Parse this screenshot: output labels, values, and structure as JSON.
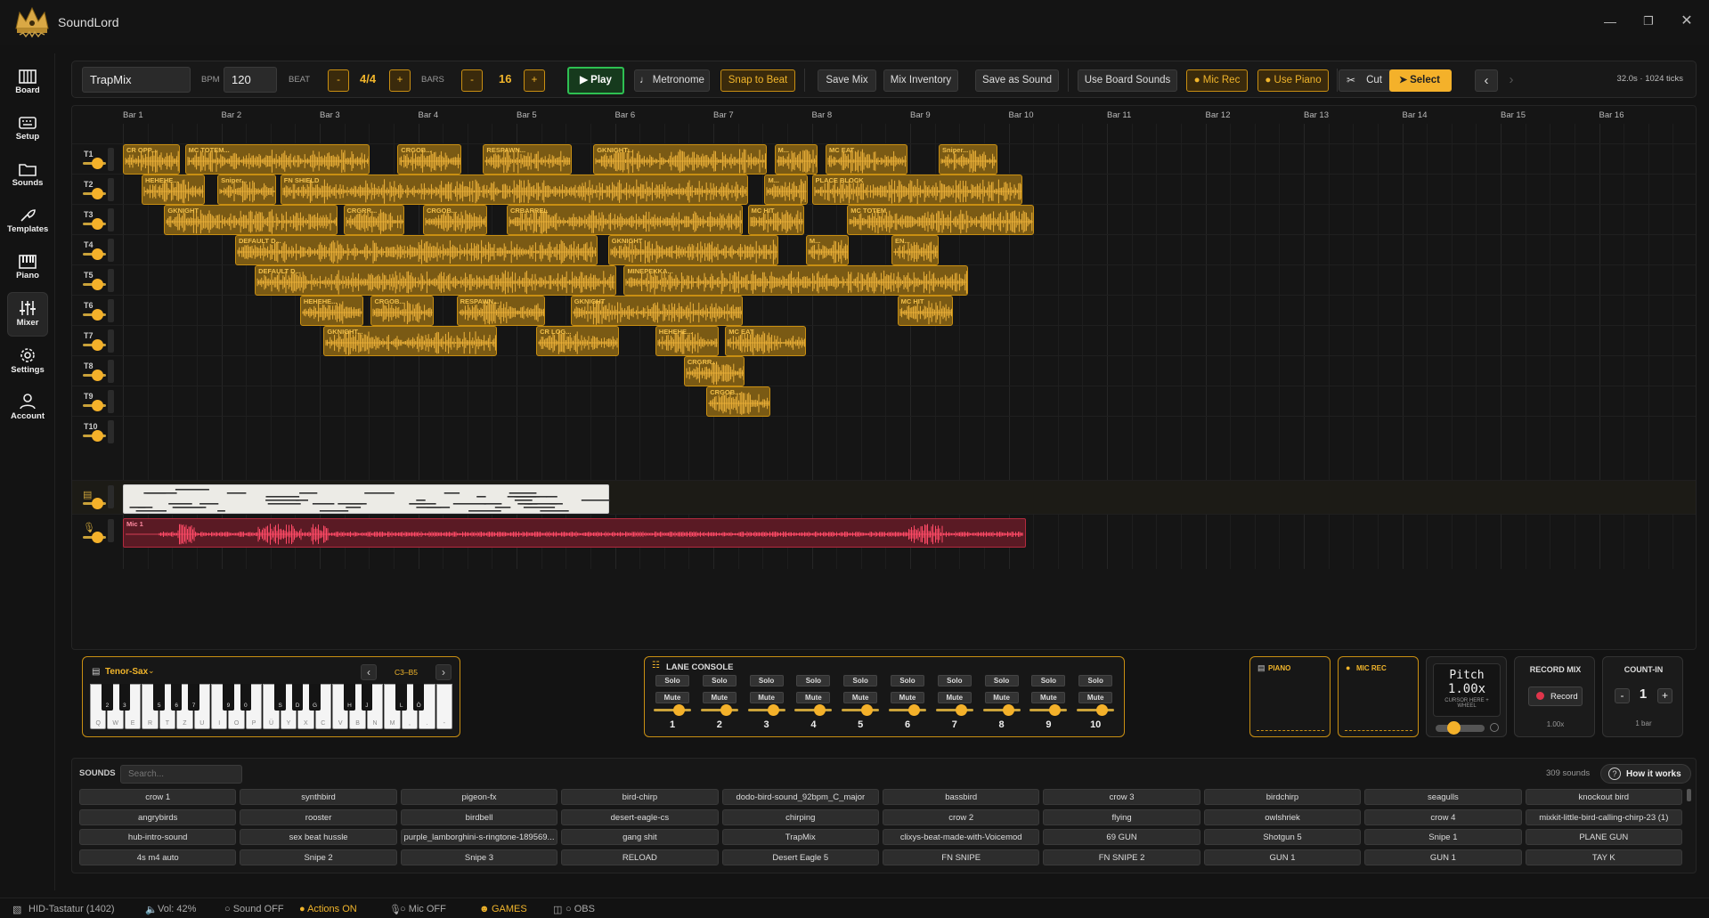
{
  "app": {
    "title": "SoundLord"
  },
  "sidebar": {
    "items": [
      {
        "label": "Board",
        "icon": "piano-grid-icon"
      },
      {
        "label": "Setup",
        "icon": "keyboard-icon"
      },
      {
        "label": "Sounds",
        "icon": "folder-icon"
      },
      {
        "label": "Templates",
        "icon": "templates-icon"
      },
      {
        "label": "Piano",
        "icon": "piano-icon"
      },
      {
        "label": "Mixer",
        "icon": "mixer-icon"
      },
      {
        "label": "Settings",
        "icon": "gear-icon"
      },
      {
        "label": "Account",
        "icon": "user-icon"
      }
    ]
  },
  "toolbar": {
    "project_name": "TrapMix",
    "bpm_label": "BPM",
    "bpm_value": "120",
    "beat_label": "BEAT",
    "beat_value": "4/4",
    "bars_label": "BARS",
    "bars_value": "16",
    "minus": "-",
    "plus": "+",
    "play_label": "▶ Play",
    "metronome_label": "♩ Metronome",
    "snap_label": "Snap to Beat",
    "save_mix_label": "Save Mix",
    "mix_inventory_label": "Mix Inventory",
    "save_sound_label": "Save as Sound",
    "board_sounds_label": "Use Board Sounds",
    "mic_rec_label": "● Mic Rec",
    "use_piano_label": "● Use Piano",
    "cut_label": "Cut",
    "select_label": "Select",
    "prev": "‹",
    "next": "›",
    "duration_info": "32.0s · 1024 ticks"
  },
  "timeline": {
    "bars": [
      "Bar 1",
      "Bar 2",
      "Bar 3",
      "Bar 4",
      "Bar 5",
      "Bar 6",
      "Bar 7",
      "Bar 8",
      "Bar 9",
      "Bar 10",
      "Bar 11",
      "Bar 12",
      "Bar 13",
      "Bar 14",
      "Bar 15",
      "Bar 16"
    ],
    "lanes": [
      "T1",
      "T2",
      "T3",
      "T4",
      "T5",
      "T6",
      "T7",
      "T8",
      "T9",
      "T10"
    ],
    "clips": [
      {
        "lane": 0,
        "start": 0.0,
        "len": 0.58,
        "name": "CR OPP..."
      },
      {
        "lane": 0,
        "start": 0.63,
        "len": 1.88,
        "name": "MC TOTEM..."
      },
      {
        "lane": 0,
        "start": 2.79,
        "len": 0.65,
        "name": "CRGOB..."
      },
      {
        "lane": 0,
        "start": 3.66,
        "len": 0.9,
        "name": "RESPAWN..."
      },
      {
        "lane": 0,
        "start": 4.78,
        "len": 1.76,
        "name": "GKNIGHT..."
      },
      {
        "lane": 0,
        "start": 6.62,
        "len": 0.44,
        "name": "M..."
      },
      {
        "lane": 0,
        "start": 7.14,
        "len": 0.83,
        "name": "MC EAT"
      },
      {
        "lane": 0,
        "start": 8.29,
        "len": 0.6,
        "name": "Sniper..."
      },
      {
        "lane": 1,
        "start": 0.19,
        "len": 0.64,
        "name": "HEHEHE..."
      },
      {
        "lane": 1,
        "start": 0.96,
        "len": 0.6,
        "name": "Sniper..."
      },
      {
        "lane": 1,
        "start": 1.6,
        "len": 4.75,
        "name": "FN SHIELD"
      },
      {
        "lane": 1,
        "start": 6.52,
        "len": 0.44,
        "name": "M..."
      },
      {
        "lane": 1,
        "start": 7.0,
        "len": 2.14,
        "name": "PLACE BLOCK"
      },
      {
        "lane": 2,
        "start": 0.42,
        "len": 1.76,
        "name": "GKNIGHT"
      },
      {
        "lane": 2,
        "start": 2.24,
        "len": 0.62,
        "name": "CRGRR..."
      },
      {
        "lane": 2,
        "start": 3.05,
        "len": 0.65,
        "name": "CRGOB..."
      },
      {
        "lane": 2,
        "start": 3.9,
        "len": 2.4,
        "name": "CRBARREL"
      },
      {
        "lane": 2,
        "start": 6.35,
        "len": 0.57,
        "name": "MC HIT"
      },
      {
        "lane": 2,
        "start": 7.36,
        "len": 1.9,
        "name": "MC TOTEM"
      },
      {
        "lane": 3,
        "start": 1.14,
        "len": 3.68,
        "name": "DEFAULT D..."
      },
      {
        "lane": 3,
        "start": 4.93,
        "len": 1.73,
        "name": "GKNIGHT"
      },
      {
        "lane": 3,
        "start": 6.94,
        "len": 0.44,
        "name": "M..."
      },
      {
        "lane": 3,
        "start": 7.81,
        "len": 0.48,
        "name": "EN..."
      },
      {
        "lane": 4,
        "start": 1.34,
        "len": 3.67,
        "name": "DEFAULT D..."
      },
      {
        "lane": 4,
        "start": 5.09,
        "len": 3.5,
        "name": "MINEPEKKA..."
      },
      {
        "lane": 5,
        "start": 1.8,
        "len": 0.64,
        "name": "HEHEHE..."
      },
      {
        "lane": 5,
        "start": 2.52,
        "len": 0.64,
        "name": "CRGOB..."
      },
      {
        "lane": 5,
        "start": 3.39,
        "len": 0.9,
        "name": "RESPAWN..."
      },
      {
        "lane": 5,
        "start": 4.55,
        "len": 1.75,
        "name": "GKNIGHT"
      },
      {
        "lane": 5,
        "start": 7.87,
        "len": 0.56,
        "name": "MC HIT"
      },
      {
        "lane": 6,
        "start": 2.04,
        "len": 1.76,
        "name": "GKNIGHT..."
      },
      {
        "lane": 6,
        "start": 4.2,
        "len": 0.84,
        "name": "CR LOG..."
      },
      {
        "lane": 6,
        "start": 5.41,
        "len": 0.64,
        "name": "HEHEHE..."
      },
      {
        "lane": 6,
        "start": 6.12,
        "len": 0.82,
        "name": "MC EAT"
      },
      {
        "lane": 7,
        "start": 5.7,
        "len": 0.62,
        "name": "CRGRR..."
      },
      {
        "lane": 8,
        "start": 5.93,
        "len": 0.65,
        "name": "CRGOB..."
      }
    ],
    "mic_clip_name": "Mic 1"
  },
  "piano_panel": {
    "instrument": "Tenor-Sax",
    "range": "C3–B5",
    "white_keys": [
      "Q",
      "W",
      "E",
      "R",
      "T",
      "Z",
      "U",
      "I",
      "O",
      "P",
      "Ü",
      "Y",
      "X",
      "C",
      "V",
      "B",
      "N",
      "M",
      ",",
      ".",
      "-"
    ],
    "black_keys": [
      "2",
      "3",
      "5",
      "6",
      "7",
      "9",
      "0",
      "S",
      "D",
      "G",
      "H",
      "J",
      "L",
      "Ö"
    ]
  },
  "lane_console": {
    "title": "LANE CONSOLE",
    "solo": "Solo",
    "mute": "Mute",
    "lanes": [
      "1",
      "2",
      "3",
      "4",
      "5",
      "6",
      "7",
      "8",
      "9",
      "10"
    ]
  },
  "right_panels": {
    "piano_label": "PIANO",
    "mic_label": "MIC REC",
    "pitch_title": "Pitch",
    "pitch_value": "1.00x",
    "pitch_hint_1": "CURSOR HERE +",
    "pitch_hint_2": "WHEEL",
    "record_title": "RECORD MIX",
    "record_label": "Record",
    "record_speed": "1.00x",
    "countin_title": "COUNT-IN",
    "countin_value": "1",
    "countin_unit": "1 bar",
    "minus": "-",
    "plus": "+"
  },
  "sounds": {
    "title": "SOUNDS",
    "search_placeholder": "Search...",
    "count": "309 sounds",
    "how_it_works": "How it works",
    "rows": [
      [
        "crow 1",
        "synthbird",
        "pigeon-fx",
        "bird-chirp",
        "dodo-bird-sound_92bpm_C_major",
        "bassbird",
        "crow 3",
        "birdchirp",
        "seagulls",
        "knockout bird"
      ],
      [
        "angrybirds",
        "rooster",
        "birdbell",
        "desert-eagle-cs",
        "chirping",
        "crow 2",
        "flying",
        "owlshriek",
        "crow 4",
        "mixkit-little-bird-calling-chirp-23 (1)"
      ],
      [
        "hub-intro-sound",
        "sex beat hussle",
        "purple_lamborghini-s-ringtone-189569...",
        "gang shit",
        "TrapMix",
        "clixys-beat-made-with-Voicemod",
        "69 GUN",
        "Shotgun 5",
        "Snipe 1",
        "PLANE GUN"
      ],
      [
        "4s m4 auto",
        "Snipe 2",
        "Snipe 3",
        "RELOAD",
        "Desert Eagle 5",
        "FN SNIPE",
        "FN SNIPE 2",
        "GUN 1",
        "GUN 1",
        "TAY K"
      ]
    ]
  },
  "statusbar": {
    "device": "HID-Tastatur (1402)",
    "volume": "Vol: 42%",
    "sound": "○ Sound OFF",
    "actions": "● Actions ON",
    "mic": "○ Mic OFF",
    "games": "GAMES",
    "obs": "○ OBS"
  },
  "colors": {
    "accent": "#f4b12a",
    "clip_fill": "#7a5a14",
    "play_green": "#2ec052",
    "mic_red": "#e0354b",
    "bg": "#131313"
  }
}
